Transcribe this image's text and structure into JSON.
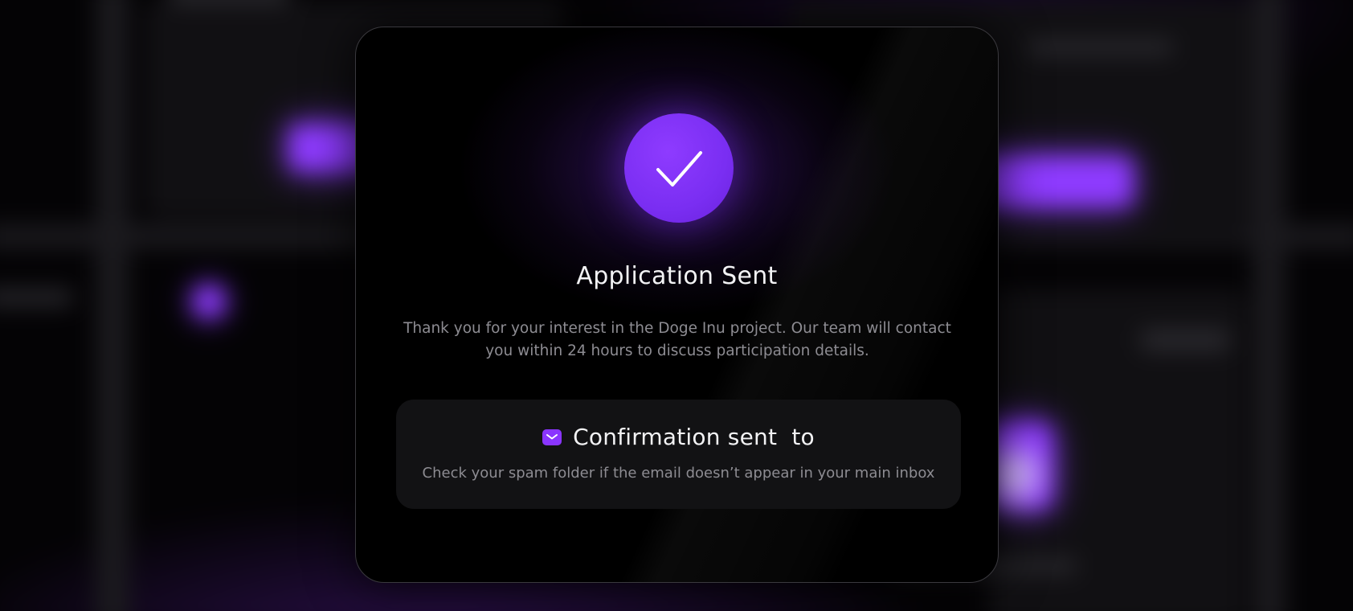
{
  "modal": {
    "title": "Application Sent",
    "description": "Thank you for your interest in the Doge Inu project. Our team will contact you within 24 hours to discuss participation details.",
    "status_icon": "check-icon",
    "confirmation": {
      "icon": "mail-icon",
      "title": "Confirmation sent  to",
      "note": "Check your spam folder if the email doesn’t appear in your main inbox"
    }
  },
  "colors": {
    "accent": "#8A35FF",
    "background": "#000000",
    "panel": "#121214",
    "text_primary": "#F2F2F4",
    "text_secondary": "#8D8C92"
  }
}
